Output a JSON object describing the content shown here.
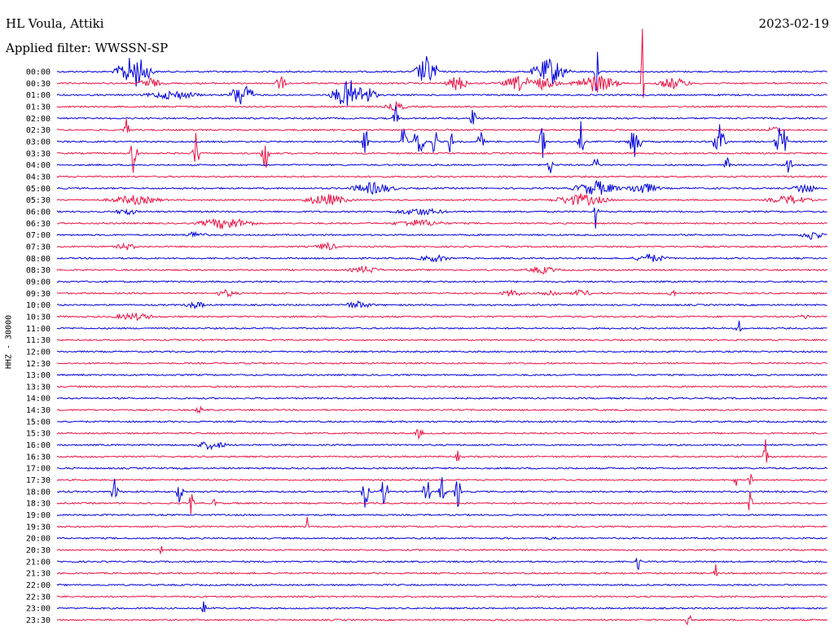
{
  "header": {
    "station": "HL Voula, Attiki",
    "date": "2023-02-19",
    "filter_label": "Applied filter: WWSSN-SP",
    "channel_scale": "HHZ - 30000"
  },
  "colors": {
    "trace_a": "#0000dd",
    "trace_b": "#ee1144",
    "background": "#ffffff"
  },
  "chart_data": {
    "type": "line",
    "title": "HL Voula, Attiki",
    "subtitle": "Applied filter: WWSSN-SP",
    "date": "2023-02-19",
    "ylabel": "HHZ - 30000",
    "xlabel": "",
    "grid": false,
    "legend": "none",
    "rows": [
      {
        "time": "00:00",
        "color": "blue",
        "events": [
          {
            "x": 0.1,
            "amp": 22,
            "w": 0.03
          },
          {
            "x": 0.48,
            "amp": 20,
            "w": 0.02
          },
          {
            "x": 0.64,
            "amp": 18,
            "w": 0.03
          },
          {
            "x": 0.7,
            "amp": 50,
            "w": 0.003
          }
        ]
      },
      {
        "time": "00:30",
        "color": "red",
        "events": [
          {
            "x": 0.12,
            "amp": 8,
            "w": 0.02
          },
          {
            "x": 0.29,
            "amp": 10,
            "w": 0.01
          },
          {
            "x": 0.52,
            "amp": 10,
            "w": 0.02
          },
          {
            "x": 0.6,
            "amp": 10,
            "w": 0.03
          },
          {
            "x": 0.63,
            "amp": 8,
            "w": 0.03
          },
          {
            "x": 0.7,
            "amp": 12,
            "w": 0.04
          },
          {
            "x": 0.76,
            "amp": 100,
            "w": 0.002
          },
          {
            "x": 0.8,
            "amp": 8,
            "w": 0.03
          }
        ]
      },
      {
        "time": "01:00",
        "color": "blue",
        "events": [
          {
            "x": 0.15,
            "amp": 6,
            "w": 0.05
          },
          {
            "x": 0.24,
            "amp": 18,
            "w": 0.02
          },
          {
            "x": 0.38,
            "amp": 20,
            "w": 0.03
          },
          {
            "x": 0.4,
            "amp": 14,
            "w": 0.02
          }
        ]
      },
      {
        "time": "01:30",
        "color": "red",
        "events": [
          {
            "x": 0.44,
            "amp": 6,
            "w": 0.02
          }
        ]
      },
      {
        "time": "02:00",
        "color": "blue",
        "events": [
          {
            "x": 0.44,
            "amp": 18,
            "w": 0.005
          },
          {
            "x": 0.54,
            "amp": 15,
            "w": 0.005
          }
        ]
      },
      {
        "time": "02:30",
        "color": "red",
        "events": [
          {
            "x": 0.09,
            "amp": 14,
            "w": 0.005
          },
          {
            "x": 0.93,
            "amp": 6,
            "w": 0.01
          }
        ]
      },
      {
        "time": "03:00",
        "color": "blue",
        "events": [
          {
            "x": 0.4,
            "amp": 22,
            "w": 0.005
          },
          {
            "x": 0.45,
            "amp": 28,
            "w": 0.005
          },
          {
            "x": 0.47,
            "amp": 24,
            "w": 0.01
          },
          {
            "x": 0.49,
            "amp": 22,
            "w": 0.005
          },
          {
            "x": 0.51,
            "amp": 20,
            "w": 0.005
          },
          {
            "x": 0.55,
            "amp": 22,
            "w": 0.005
          },
          {
            "x": 0.63,
            "amp": 26,
            "w": 0.005
          },
          {
            "x": 0.68,
            "amp": 26,
            "w": 0.005
          },
          {
            "x": 0.75,
            "amp": 28,
            "w": 0.01
          },
          {
            "x": 0.86,
            "amp": 28,
            "w": 0.01
          },
          {
            "x": 0.94,
            "amp": 28,
            "w": 0.01
          }
        ]
      },
      {
        "time": "03:30",
        "color": "red",
        "events": [
          {
            "x": 0.1,
            "amp": 30,
            "w": 0.006
          },
          {
            "x": 0.18,
            "amp": 30,
            "w": 0.006
          },
          {
            "x": 0.27,
            "amp": 30,
            "w": 0.006
          }
        ]
      },
      {
        "time": "04:00",
        "color": "blue",
        "events": [
          {
            "x": 0.64,
            "amp": 14,
            "w": 0.005
          },
          {
            "x": 0.7,
            "amp": 14,
            "w": 0.005
          },
          {
            "x": 0.87,
            "amp": 14,
            "w": 0.005
          },
          {
            "x": 0.95,
            "amp": 14,
            "w": 0.005
          }
        ]
      },
      {
        "time": "04:30",
        "color": "red",
        "events": []
      },
      {
        "time": "05:00",
        "color": "blue",
        "events": [
          {
            "x": 0.41,
            "amp": 8,
            "w": 0.04
          },
          {
            "x": 0.7,
            "amp": 10,
            "w": 0.04
          },
          {
            "x": 0.76,
            "amp": 8,
            "w": 0.03
          },
          {
            "x": 0.97,
            "amp": 8,
            "w": 0.02
          }
        ]
      },
      {
        "time": "05:30",
        "color": "red",
        "events": [
          {
            "x": 0.1,
            "amp": 6,
            "w": 0.05
          },
          {
            "x": 0.35,
            "amp": 8,
            "w": 0.04
          },
          {
            "x": 0.68,
            "amp": 8,
            "w": 0.05
          },
          {
            "x": 0.95,
            "amp": 6,
            "w": 0.04
          }
        ]
      },
      {
        "time": "06:00",
        "color": "blue",
        "events": [
          {
            "x": 0.09,
            "amp": 5,
            "w": 0.02
          },
          {
            "x": 0.47,
            "amp": 5,
            "w": 0.05
          },
          {
            "x": 0.7,
            "amp": 40,
            "w": 0.003
          }
        ]
      },
      {
        "time": "06:30",
        "color": "red",
        "events": [
          {
            "x": 0.22,
            "amp": 8,
            "w": 0.05
          },
          {
            "x": 0.47,
            "amp": 5,
            "w": 0.05
          }
        ]
      },
      {
        "time": "07:00",
        "color": "blue",
        "events": [
          {
            "x": 0.18,
            "amp": 5,
            "w": 0.02
          },
          {
            "x": 0.98,
            "amp": 7,
            "w": 0.02
          }
        ]
      },
      {
        "time": "07:30",
        "color": "red",
        "events": [
          {
            "x": 0.09,
            "amp": 5,
            "w": 0.02
          },
          {
            "x": 0.35,
            "amp": 6,
            "w": 0.02
          }
        ]
      },
      {
        "time": "08:00",
        "color": "blue",
        "events": [
          {
            "x": 0.49,
            "amp": 5,
            "w": 0.03
          },
          {
            "x": 0.77,
            "amp": 6,
            "w": 0.03
          }
        ]
      },
      {
        "time": "08:30",
        "color": "red",
        "events": [
          {
            "x": 0.4,
            "amp": 5,
            "w": 0.03
          },
          {
            "x": 0.63,
            "amp": 5,
            "w": 0.03
          }
        ]
      },
      {
        "time": "09:00",
        "color": "blue",
        "events": []
      },
      {
        "time": "09:30",
        "color": "red",
        "events": [
          {
            "x": 0.22,
            "amp": 5,
            "w": 0.02
          },
          {
            "x": 0.59,
            "amp": 5,
            "w": 0.02
          },
          {
            "x": 0.64,
            "amp": 5,
            "w": 0.02
          },
          {
            "x": 0.68,
            "amp": 5,
            "w": 0.02
          },
          {
            "x": 0.8,
            "amp": 5,
            "w": 0.01
          }
        ]
      },
      {
        "time": "10:00",
        "color": "blue",
        "events": [
          {
            "x": 0.18,
            "amp": 5,
            "w": 0.02
          },
          {
            "x": 0.39,
            "amp": 5,
            "w": 0.03
          }
        ]
      },
      {
        "time": "10:30",
        "color": "red",
        "events": [
          {
            "x": 0.1,
            "amp": 5,
            "w": 0.04
          },
          {
            "x": 0.97,
            "amp": 4,
            "w": 0.01
          }
        ]
      },
      {
        "time": "11:00",
        "color": "blue",
        "events": [
          {
            "x": 0.885,
            "amp": 16,
            "w": 0.004
          }
        ]
      },
      {
        "time": "11:30",
        "color": "red",
        "events": []
      },
      {
        "time": "12:00",
        "color": "blue",
        "events": []
      },
      {
        "time": "12:30",
        "color": "red",
        "events": []
      },
      {
        "time": "13:00",
        "color": "blue",
        "events": []
      },
      {
        "time": "13:30",
        "color": "red",
        "events": []
      },
      {
        "time": "14:00",
        "color": "blue",
        "events": []
      },
      {
        "time": "14:30",
        "color": "red",
        "events": [
          {
            "x": 0.185,
            "amp": 5,
            "w": 0.008
          }
        ]
      },
      {
        "time": "15:00",
        "color": "blue",
        "events": []
      },
      {
        "time": "15:30",
        "color": "red",
        "events": [
          {
            "x": 0.47,
            "amp": 7,
            "w": 0.008
          }
        ]
      },
      {
        "time": "16:00",
        "color": "blue",
        "events": [
          {
            "x": 0.2,
            "amp": 6,
            "w": 0.03
          }
        ]
      },
      {
        "time": "16:30",
        "color": "red",
        "events": [
          {
            "x": 0.52,
            "amp": 10,
            "w": 0.003
          },
          {
            "x": 0.92,
            "amp": 25,
            "w": 0.004
          }
        ]
      },
      {
        "time": "17:00",
        "color": "blue",
        "events": []
      },
      {
        "time": "17:30",
        "color": "red",
        "events": [
          {
            "x": 0.88,
            "amp": 14,
            "w": 0.004
          },
          {
            "x": 0.9,
            "amp": 14,
            "w": 0.004
          }
        ]
      },
      {
        "time": "18:00",
        "color": "blue",
        "events": [
          {
            "x": 0.075,
            "amp": 20,
            "w": 0.006
          },
          {
            "x": 0.16,
            "amp": 20,
            "w": 0.006
          },
          {
            "x": 0.4,
            "amp": 22,
            "w": 0.006
          },
          {
            "x": 0.425,
            "amp": 22,
            "w": 0.006
          },
          {
            "x": 0.48,
            "amp": 22,
            "w": 0.006
          },
          {
            "x": 0.5,
            "amp": 20,
            "w": 0.006
          },
          {
            "x": 0.52,
            "amp": 22,
            "w": 0.006
          }
        ]
      },
      {
        "time": "18:30",
        "color": "red",
        "events": [
          {
            "x": 0.175,
            "amp": 20,
            "w": 0.004
          },
          {
            "x": 0.205,
            "amp": 8,
            "w": 0.004
          },
          {
            "x": 0.9,
            "amp": 18,
            "w": 0.004
          }
        ]
      },
      {
        "time": "19:00",
        "color": "blue",
        "events": []
      },
      {
        "time": "19:30",
        "color": "red",
        "events": [
          {
            "x": 0.325,
            "amp": 14,
            "w": 0.003
          }
        ]
      },
      {
        "time": "20:00",
        "color": "blue",
        "events": [
          {
            "x": 0.64,
            "amp": 2,
            "w": 0.02
          }
        ]
      },
      {
        "time": "20:30",
        "color": "red",
        "events": [
          {
            "x": 0.135,
            "amp": 14,
            "w": 0.003
          }
        ]
      },
      {
        "time": "21:00",
        "color": "blue",
        "events": [
          {
            "x": 0.755,
            "amp": 16,
            "w": 0.004
          }
        ]
      },
      {
        "time": "21:30",
        "color": "red",
        "events": [
          {
            "x": 0.855,
            "amp": 14,
            "w": 0.004
          }
        ]
      },
      {
        "time": "22:00",
        "color": "blue",
        "events": []
      },
      {
        "time": "22:30",
        "color": "red",
        "events": []
      },
      {
        "time": "23:00",
        "color": "blue",
        "events": [
          {
            "x": 0.19,
            "amp": 14,
            "w": 0.004
          }
        ]
      },
      {
        "time": "23:30",
        "color": "red",
        "events": [
          {
            "x": 0.82,
            "amp": 18,
            "w": 0.004
          }
        ]
      }
    ]
  }
}
